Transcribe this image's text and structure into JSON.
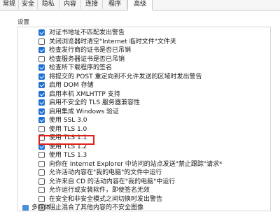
{
  "tabs": [
    "常规",
    "安全",
    "隐私",
    "内容",
    "连接",
    "程序",
    "高级"
  ],
  "active_tab": "高级",
  "settings_label": "设置",
  "items": [
    {
      "label": "对证书地址不匹配发出警告",
      "checked": true
    },
    {
      "label": "关闭浏览器时清空\"Internet 临时文件\"文件夹",
      "checked": false
    },
    {
      "label": "检查发行商的证书是否已吊销",
      "checked": true
    },
    {
      "label": "检查服务器证书是否已吊销",
      "checked": false
    },
    {
      "label": "检查所下载程序的签名",
      "checked": true
    },
    {
      "label": "将提交的 POST 重定向到不允许发送的区域时发出警告",
      "checked": true
    },
    {
      "label": "启用 DOM 存储",
      "checked": true
    },
    {
      "label": "启用本机 XMLHTTP 支持",
      "checked": true
    },
    {
      "label": "启用不安全的 TLS 服务器兼容性",
      "checked": true
    },
    {
      "label": "启用集成 Windows 验证",
      "checked": true
    },
    {
      "label": "使用 SSL 3.0",
      "checked": true
    },
    {
      "label": "使用 TLS 1.0",
      "checked": false
    },
    {
      "label": "使用 TLS 1.1",
      "checked": false
    },
    {
      "label": "使用 TLS 1.2",
      "checked": true
    },
    {
      "label": "使用 TLS 1.3",
      "checked": false
    },
    {
      "label": "向你在 Internet Explorer 中访问的站点发送\"禁止跟踪\"请求*",
      "checked": false
    },
    {
      "label": "允许活动内容在\"我的电脑\"的文件中运行",
      "checked": false
    },
    {
      "label": "允许来自 CD 的活动内容在\"我的电脑\"中运行",
      "checked": false
    },
    {
      "label": "允许运行或安装软件，即使签名无效",
      "checked": false
    },
    {
      "label": "在安全和非安全模式之间切换时发出警告",
      "checked": false
    },
    {
      "label": "阻止混合了其他内容的不安全图像",
      "checked": false
    }
  ],
  "folder_label": "多媒体",
  "colors": {
    "checked": "#1f6fd1",
    "highlight": "#e0201a"
  }
}
